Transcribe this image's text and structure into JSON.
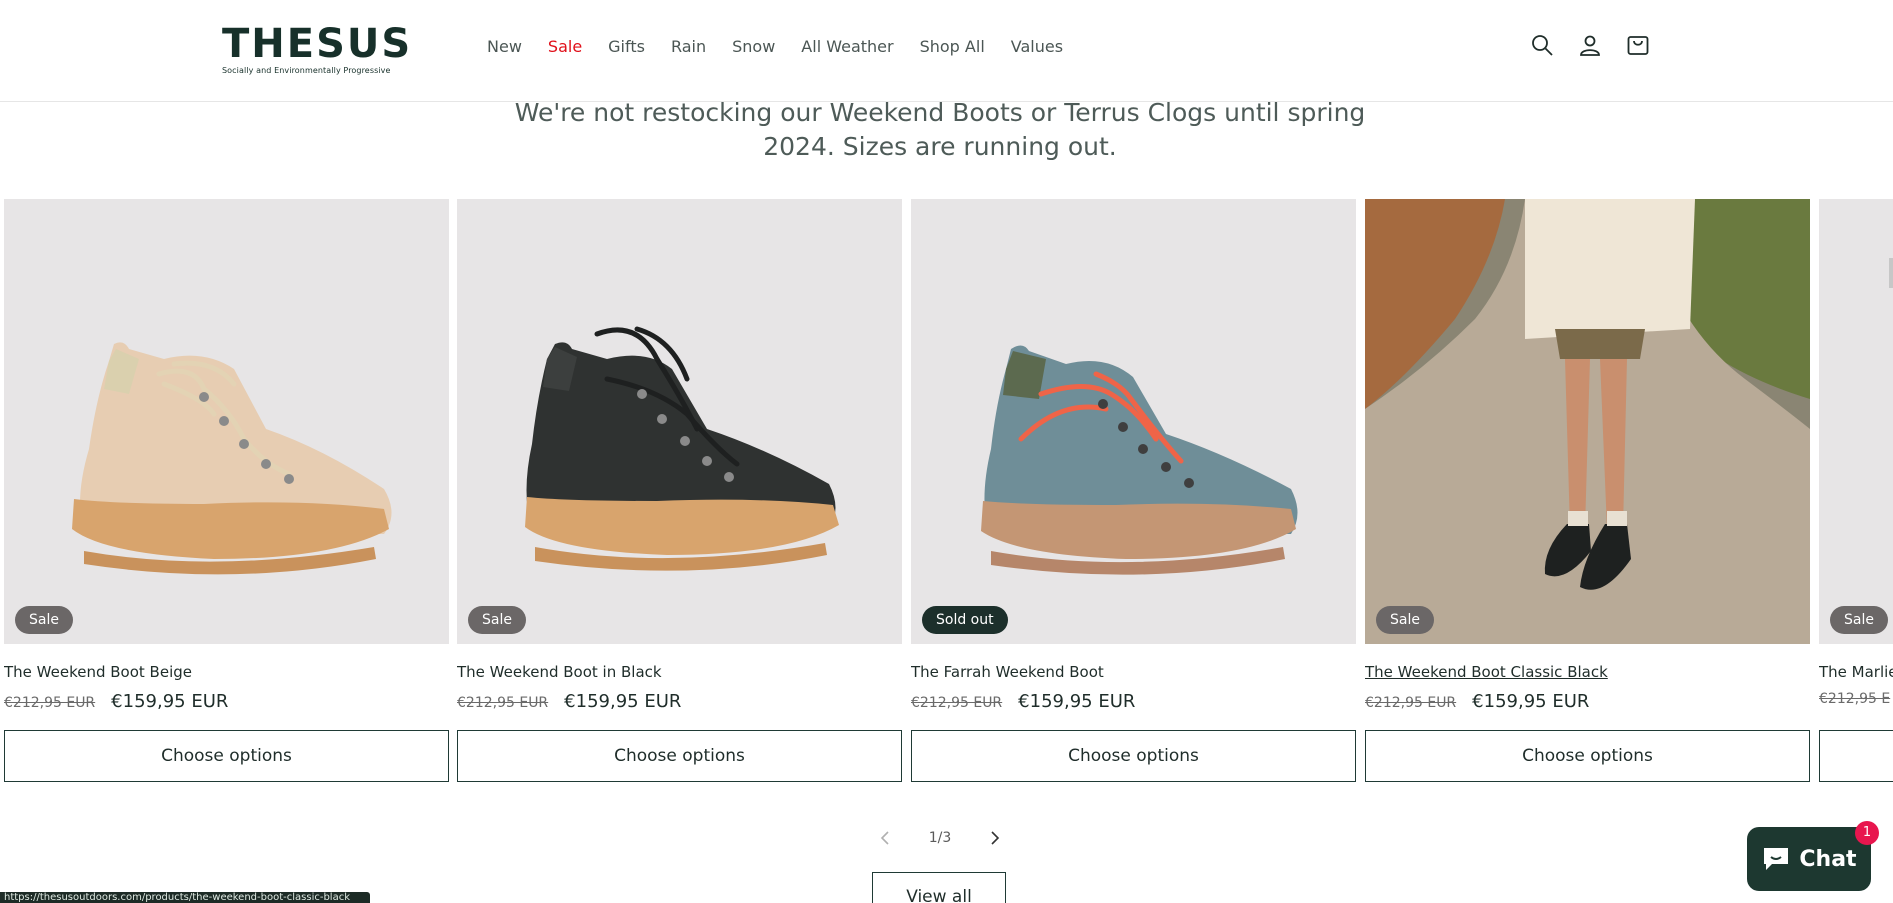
{
  "brand": {
    "name": "THESUS",
    "tagline": "Socially and Environmentally Progressive"
  },
  "nav": [
    "New",
    "Sale",
    "Gifts",
    "Rain",
    "Snow",
    "All Weather",
    "Shop All",
    "Values"
  ],
  "notice": "We're not restocking our Weekend Boots or Terrus Clogs until spring 2024. Sizes are running out.",
  "products": [
    {
      "title": "The Weekend Boot Beige",
      "old_price": "€212,95 EUR",
      "price": "€159,95 EUR",
      "badge": "Sale",
      "button": "Choose options"
    },
    {
      "title": "The Weekend Boot in Black",
      "old_price": "€212,95 EUR",
      "price": "€159,95 EUR",
      "badge": "Sale",
      "button": "Choose options"
    },
    {
      "title": "The Farrah Weekend Boot",
      "old_price": "€212,95 EUR",
      "price": "€159,95 EUR",
      "badge": "Sold out",
      "button": "Choose options"
    },
    {
      "title": "The Weekend Boot Classic Black",
      "old_price": "€212,95 EUR",
      "price": "€159,95 EUR",
      "badge": "Sale",
      "button": "Choose options"
    },
    {
      "title": "The Marlie",
      "old_price": "€212,95 E",
      "price": "",
      "badge": "Sale",
      "button": ""
    }
  ],
  "pagination": {
    "text": "1/3"
  },
  "view_all": "View all",
  "status_url": "https://thesusoutdoors.com/products/the-weekend-boot-classic-black",
  "chat": {
    "label": "Chat",
    "count": "1"
  },
  "colors": {
    "sale_red": "#e0101a",
    "brand_green": "#1d3830",
    "card_bg": "#e7e5e6"
  }
}
